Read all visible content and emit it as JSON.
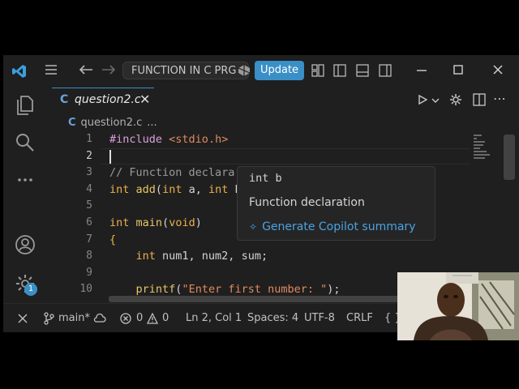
{
  "titlebar": {
    "command_center": "FUNCTION IN C PRG",
    "update_label": "Update"
  },
  "tab": {
    "icon_text": "C",
    "name": "question2.c"
  },
  "breadcrumb": {
    "icon_text": "C",
    "file": "question2.c",
    "more": "..."
  },
  "line_numbers": [
    "1",
    "2",
    "3",
    "4",
    "5",
    "6",
    "7",
    "8",
    "9",
    "10"
  ],
  "hover": {
    "signature": "int b",
    "description": "Function declaration",
    "action": "Generate Copilot summary"
  },
  "activity": {
    "settings_badge": "1"
  },
  "statusbar": {
    "branch": "main*",
    "errors": "0",
    "warnings": "0",
    "position": "Ln 2, Col 1",
    "spaces": "Spaces: 4",
    "encoding": "UTF-8",
    "eol": "CRLF",
    "language": "{ }"
  },
  "colors": {
    "accent": "#3a8fc7",
    "editor_bg": "#1f1f1f",
    "keyword": "#ecb04c"
  }
}
